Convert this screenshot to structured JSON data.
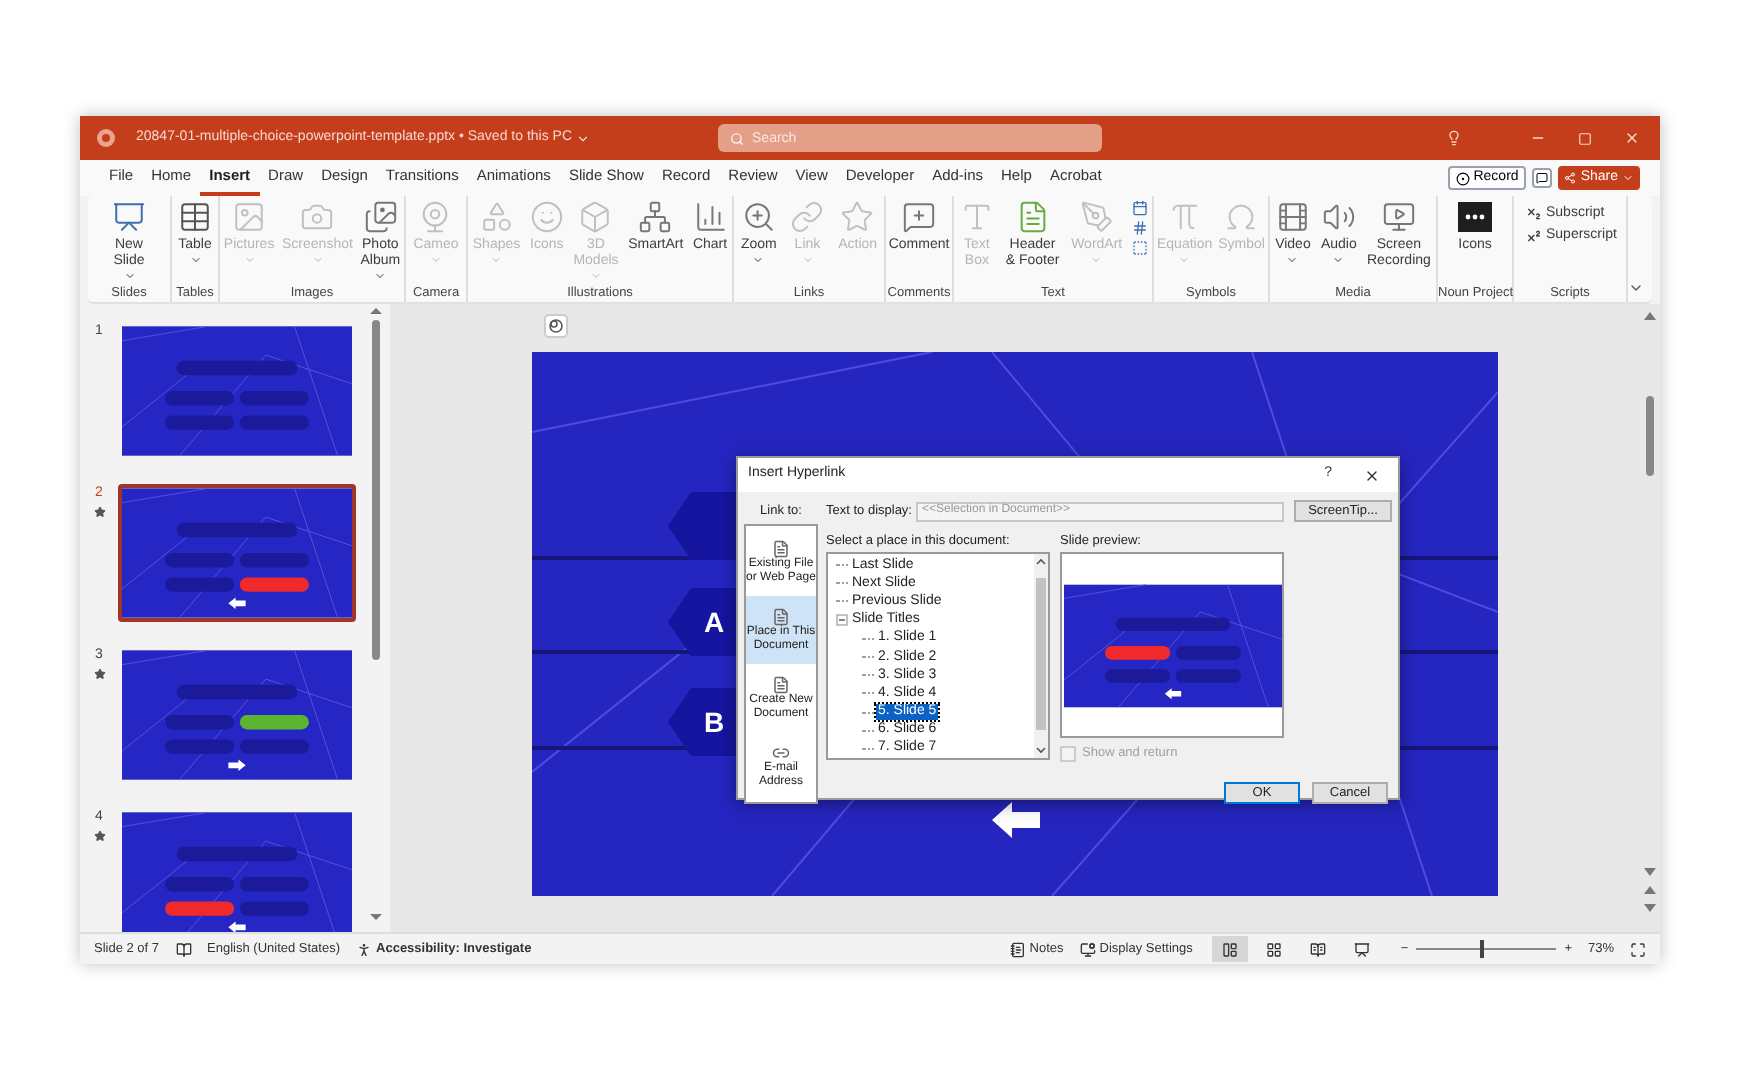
{
  "window": {
    "title": "20847-01-multiple-choice-powerpoint-template.pptx • Saved to this PC"
  },
  "search": {
    "placeholder": "Search"
  },
  "tabs": [
    {
      "label": "File",
      "selected": false
    },
    {
      "label": "Home",
      "selected": false
    },
    {
      "label": "Insert",
      "selected": true
    },
    {
      "label": "Draw",
      "selected": false
    },
    {
      "label": "Design",
      "selected": false
    },
    {
      "label": "Transitions",
      "selected": false
    },
    {
      "label": "Animations",
      "selected": false
    },
    {
      "label": "Slide Show",
      "selected": false
    },
    {
      "label": "Record",
      "selected": false
    },
    {
      "label": "Review",
      "selected": false
    },
    {
      "label": "View",
      "selected": false
    },
    {
      "label": "Developer",
      "selected": false
    },
    {
      "label": "Add-ins",
      "selected": false
    },
    {
      "label": "Help",
      "selected": false
    },
    {
      "label": "Acrobat",
      "selected": false
    }
  ],
  "header_buttons": {
    "record": "Record",
    "share": "Share"
  },
  "ribbon": {
    "groups": [
      {
        "label": "Slides",
        "items": [
          {
            "label": "New\nSlide",
            "kind": "large",
            "disabled": false,
            "menu": true
          }
        ]
      },
      {
        "label": "Tables",
        "items": [
          {
            "label": "Table",
            "kind": "large",
            "disabled": false,
            "menu": true
          }
        ]
      },
      {
        "label": "Images",
        "items": [
          {
            "label": "Pictures",
            "kind": "large",
            "disabled": true,
            "menu": true
          },
          {
            "label": "Screenshot",
            "kind": "large",
            "disabled": true,
            "menu": true
          },
          {
            "label": "Photo\nAlbum",
            "kind": "large",
            "disabled": false,
            "menu": true
          }
        ]
      },
      {
        "label": "Camera",
        "items": [
          {
            "label": "Cameo",
            "kind": "large",
            "disabled": true,
            "menu": true
          }
        ]
      },
      {
        "label": "Illustrations",
        "items": [
          {
            "label": "Shapes",
            "kind": "large",
            "disabled": true,
            "menu": true
          },
          {
            "label": "Icons",
            "kind": "large",
            "disabled": true,
            "menu": false
          },
          {
            "label": "3D\nModels",
            "kind": "large",
            "disabled": true,
            "menu": true
          },
          {
            "label": "SmartArt",
            "kind": "large",
            "disabled": false,
            "menu": false
          },
          {
            "label": "Chart",
            "kind": "large",
            "disabled": false,
            "menu": false
          }
        ]
      },
      {
        "label": "Links",
        "items": [
          {
            "label": "Zoom",
            "kind": "large",
            "disabled": false,
            "menu": true
          },
          {
            "label": "Link",
            "kind": "large",
            "disabled": true,
            "menu": true
          },
          {
            "label": "Action",
            "kind": "large",
            "disabled": true,
            "menu": false
          }
        ]
      },
      {
        "label": "Comments",
        "items": [
          {
            "label": "Comment",
            "kind": "large",
            "disabled": false,
            "menu": false
          }
        ]
      },
      {
        "label": "Text",
        "items": [
          {
            "label": "Text\nBox",
            "kind": "large",
            "disabled": true,
            "menu": false
          },
          {
            "label": "Header\n& Footer",
            "kind": "large",
            "disabled": false,
            "menu": false
          },
          {
            "label": "WordArt",
            "kind": "large",
            "disabled": true,
            "menu": true
          }
        ]
      },
      {
        "label": "Symbols",
        "items": [
          {
            "label": "Equation",
            "kind": "large",
            "disabled": true,
            "menu": true
          },
          {
            "label": "Symbol",
            "kind": "large",
            "disabled": true,
            "menu": false
          }
        ]
      },
      {
        "label": "Media",
        "items": [
          {
            "label": "Video",
            "kind": "large",
            "disabled": false,
            "menu": true
          },
          {
            "label": "Audio",
            "kind": "large",
            "disabled": false,
            "menu": true
          },
          {
            "label": "Screen\nRecording",
            "kind": "large",
            "disabled": false,
            "menu": false
          }
        ]
      },
      {
        "label": "Noun Project",
        "items": [
          {
            "label": "Icons",
            "kind": "large",
            "disabled": false,
            "menu": false
          }
        ]
      },
      {
        "label": "Scripts",
        "items": [
          {
            "label": "Subscript",
            "kind": "small",
            "disabled": false,
            "menu": false
          },
          {
            "label": "Superscript",
            "kind": "small",
            "disabled": false,
            "menu": false
          }
        ]
      }
    ]
  },
  "slide_panel": {
    "slides": [
      {
        "number": "1",
        "selected": false,
        "animated": false,
        "kind": "no-arrow",
        "answers": [
          {
            "color": "#1a1a9a"
          },
          {
            "color": "#1a1a9a"
          },
          {
            "color": "#1a1a9a"
          },
          {
            "color": "#1a1a9a"
          }
        ]
      },
      {
        "number": "2",
        "selected": true,
        "animated": true,
        "kind": "left-arrow",
        "answers": [
          {
            "color": "#1a1a9a"
          },
          {
            "color": "#1a1a9a"
          },
          {
            "color": "#1a1a9a"
          },
          {
            "color": "#f02a2a"
          }
        ]
      },
      {
        "number": "3",
        "selected": false,
        "animated": true,
        "kind": "right-arrow",
        "answers": [
          {
            "color": "#1a1a9a"
          },
          {
            "color": "#5cb531"
          },
          {
            "color": "#1a1a9a"
          },
          {
            "color": "#1a1a9a"
          }
        ]
      },
      {
        "number": "4",
        "selected": false,
        "animated": true,
        "kind": "left-arrow",
        "answers": [
          {
            "color": "#1a1a9a"
          },
          {
            "color": "#1a1a9a"
          },
          {
            "color": "#f02a2a"
          },
          {
            "color": "#1a1a9a"
          }
        ]
      }
    ]
  },
  "slide": {
    "answers": [
      {
        "letter": "A"
      },
      {
        "letter": "B"
      }
    ]
  },
  "dialog": {
    "title": "Insert Hyperlink",
    "help": "?",
    "link_to_label": "Link to:",
    "link_targets": [
      {
        "label": "Existing File\nor Web Page",
        "selected": false
      },
      {
        "label": "Place in This\nDocument",
        "selected": true
      },
      {
        "label": "Create New\nDocument",
        "selected": false
      },
      {
        "label": "E-mail\nAddress",
        "selected": false
      }
    ],
    "text_to_display": {
      "label": "Text to display:",
      "value": "<<Selection in Document>>",
      "disabled": true
    },
    "screentip": "ScreenTip...",
    "place_label": "Select a place in this document:",
    "tree": [
      {
        "label": "Last Slide",
        "selected": false
      },
      {
        "label": "Next Slide",
        "selected": false
      },
      {
        "label": "Previous Slide",
        "selected": false
      },
      {
        "label": "Slide Titles",
        "selected": false,
        "expanded": true,
        "children": [
          {
            "label": "1. Slide 1",
            "selected": false
          },
          {
            "label": "2. Slide 2",
            "selected": false
          },
          {
            "label": "3. Slide 3",
            "selected": false
          },
          {
            "label": "4. Slide 4",
            "selected": false
          },
          {
            "label": "5. Slide 5",
            "selected": true
          },
          {
            "label": "6. Slide 6",
            "selected": false
          },
          {
            "label": "7. Slide 7",
            "selected": false
          }
        ]
      }
    ],
    "preview_label": "Slide preview:",
    "preview": {
      "answers": [
        {
          "color": "#f02a2a"
        },
        {
          "color": "#1a1a9a"
        },
        {
          "color": "#1a1a9a"
        },
        {
          "color": "#1a1a9a"
        }
      ]
    },
    "show_and_return": {
      "label": "Show and return",
      "checked": false,
      "disabled": true
    },
    "buttons": [
      {
        "label": "OK",
        "default": true
      },
      {
        "label": "Cancel",
        "default": false
      }
    ]
  },
  "status_bar": {
    "slide": "Slide 2 of 7",
    "language": "English (United States)",
    "accessibility": "Accessibility: Investigate",
    "notes": "Notes",
    "display": "Display Settings",
    "views": [
      {
        "selected": true
      },
      {
        "selected": false
      },
      {
        "selected": false
      },
      {
        "selected": false
      }
    ],
    "zoom": {
      "minus": "−",
      "plus": "+",
      "level": 0.45,
      "reading": "73%"
    }
  }
}
